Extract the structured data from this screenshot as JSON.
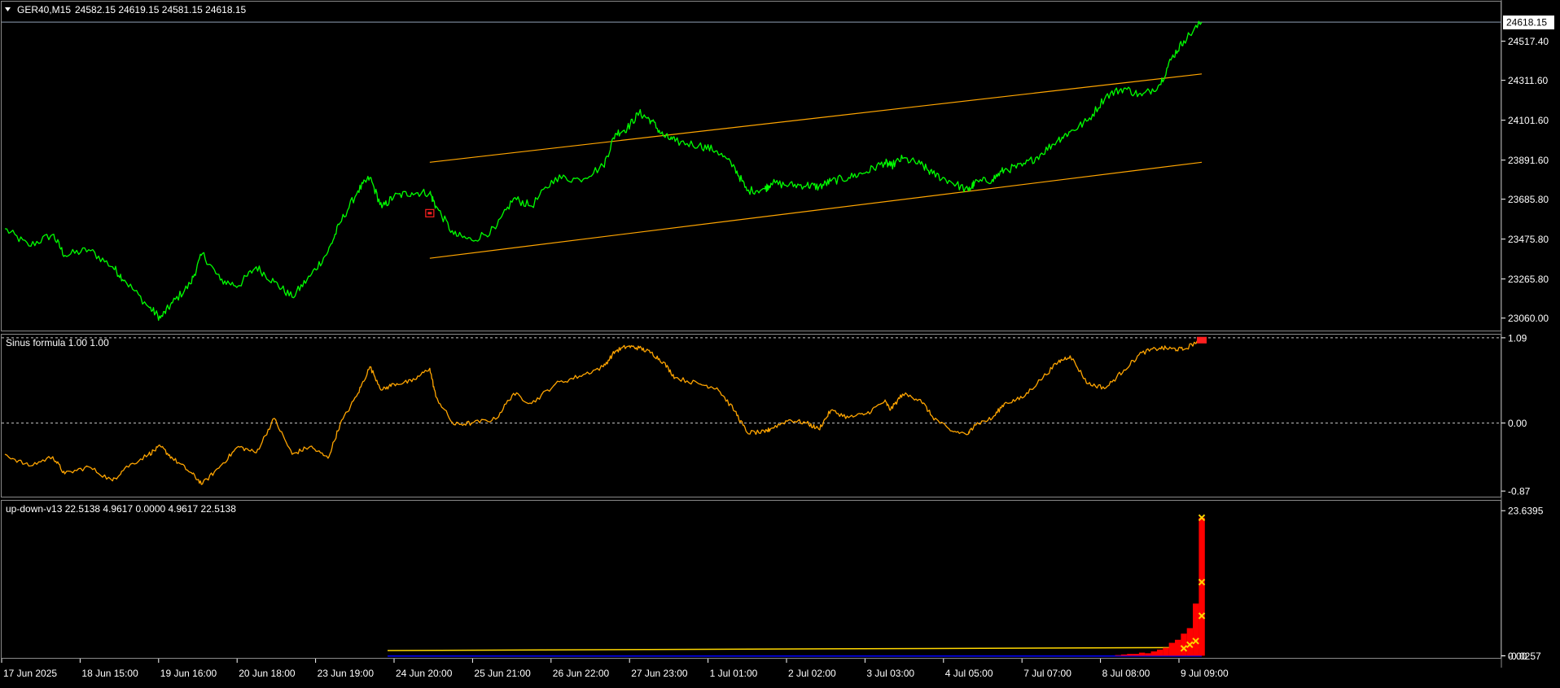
{
  "header": {
    "symbol_label": "GER40,M15",
    "ohlc": "24582.15 24619.15 24581.15 24618.15",
    "current_price": "24618.15"
  },
  "colors": {
    "background": "#000000",
    "price_line": "#00ff00",
    "channel": "#ffa500",
    "osc_line": "#ffa500",
    "up_down_bars": "#ff0000",
    "up_down_marker": "#ffd700",
    "up_down_line": "#ffd700",
    "baseline": "#0000ff",
    "axis_text": "#ffffff",
    "separator": "#808080",
    "price_marker_bg": "#ffffff"
  },
  "x_axis": {
    "labels": [
      "17 Jun 2025",
      "18 Jun 15:00",
      "19 Jun 16:00",
      "20 Jun 18:00",
      "23 Jun 19:00",
      "24 Jun 20:00",
      "25 Jun 21:00",
      "26 Jun 22:00",
      "27 Jun 23:00",
      "1 Jul 01:00",
      "2 Jul 02:00",
      "3 Jul 03:00",
      "4 Jul 05:00",
      "7 Jul 07:00",
      "8 Jul 08:00",
      "9 Jul 09:00"
    ]
  },
  "chart_data": [
    {
      "type": "line",
      "name": "main",
      "y_ticks": [
        "24517.40",
        "24311.60",
        "24101.60",
        "23891.60",
        "23685.80",
        "23475.80",
        "23265.80",
        "23060.00"
      ],
      "ylim": [
        23020,
        24640
      ],
      "x_index_range": [
        0,
        100
      ],
      "series": [
        {
          "name": "GER40,M15",
          "x": [
            0,
            2,
            4,
            5,
            7,
            9,
            10,
            12,
            13,
            14,
            15.5,
            16.5,
            18,
            19.5,
            21,
            22.5,
            24,
            25.5,
            27,
            28,
            29.5,
            30.5,
            31.5,
            32.5,
            34,
            35.5,
            36,
            37.5,
            39,
            41,
            42.5,
            44,
            46,
            48,
            50,
            51,
            52,
            53,
            54,
            55,
            56,
            58,
            59.5,
            61,
            62,
            63.5,
            64,
            65.5,
            67,
            68,
            69,
            70.5,
            72,
            73.5,
            74,
            75,
            76.5,
            77.5,
            79,
            80.5,
            81,
            82.5,
            83.5,
            85,
            86.5,
            88,
            89,
            90.5,
            92,
            93.5,
            95,
            96.5,
            97.5,
            98.5,
            100
          ],
          "values": [
            23530,
            23440,
            23500,
            23390,
            23420,
            23330,
            23260,
            23120,
            23060,
            23140,
            23240,
            23400,
            23260,
            23230,
            23330,
            23250,
            23170,
            23280,
            23410,
            23560,
            23730,
            23800,
            23640,
            23700,
            23720,
            23720,
            23650,
            23500,
            23470,
            23530,
            23690,
            23650,
            23800,
            23790,
            23860,
            24030,
            24060,
            24140,
            24100,
            24020,
            23990,
            23970,
            23940,
            23850,
            23730,
            23740,
            23770,
            23760,
            23760,
            23750,
            23780,
            23800,
            23830,
            23880,
            23860,
            23900,
            23870,
            23820,
            23780,
            23730,
            23770,
            23790,
            23840,
            23860,
            23920,
            24000,
            24040,
            24100,
            24230,
            24270,
            24230,
            24290,
            24430,
            24520,
            24618
          ]
        }
      ],
      "channel": {
        "upper": {
          "x": [
            35.5,
            100
          ],
          "values": [
            23880,
            24345
          ]
        },
        "lower": {
          "x": [
            35.5,
            100
          ],
          "values": [
            23375,
            23880
          ]
        }
      },
      "annotation": {
        "type": "red-square",
        "x": 35.5,
        "value": 23610
      }
    },
    {
      "type": "line",
      "name": "oscillator",
      "title": "Sinus formula 1.00 1.00",
      "y_ticks": [
        "1.09",
        "0.00",
        "-0.87"
      ],
      "level_lines": [
        1.09,
        0.0
      ],
      "ylim": [
        -0.9,
        1.12
      ],
      "x_index_range": [
        0,
        100
      ],
      "series": [
        {
          "name": "Sinus formula",
          "x": [
            0,
            2,
            4,
            5,
            7,
            9,
            10,
            12,
            13,
            14,
            15.5,
            16.5,
            18,
            19.5,
            21,
            22.5,
            24,
            25.5,
            27,
            28,
            29.5,
            30.5,
            31.5,
            32.5,
            34,
            35.5,
            36,
            37.5,
            39,
            41,
            42.5,
            44,
            46,
            48,
            50,
            51,
            52,
            53,
            54,
            55,
            56,
            58,
            59.5,
            61,
            62,
            63.5,
            64,
            65.5,
            67,
            68,
            69,
            70.5,
            72,
            73.5,
            74,
            75,
            76.5,
            77.5,
            79,
            80.5,
            81,
            82.5,
            83.5,
            85,
            86.5,
            88,
            89,
            90.5,
            92,
            93.5,
            95,
            96.5,
            97.5,
            98.5,
            100
          ],
          "values": [
            -0.4,
            -0.55,
            -0.43,
            -0.65,
            -0.56,
            -0.74,
            -0.58,
            -0.4,
            -0.3,
            -0.45,
            -0.63,
            -0.78,
            -0.55,
            -0.3,
            -0.38,
            0.06,
            -0.4,
            -0.3,
            -0.45,
            -0.02,
            0.38,
            0.72,
            0.42,
            0.5,
            0.53,
            0.7,
            0.34,
            -0.02,
            0.0,
            0.05,
            0.38,
            0.25,
            0.5,
            0.6,
            0.72,
            0.92,
            0.98,
            0.96,
            0.9,
            0.78,
            0.58,
            0.5,
            0.45,
            0.15,
            -0.12,
            -0.12,
            -0.07,
            0.04,
            0.0,
            -0.08,
            0.16,
            0.07,
            0.12,
            0.28,
            0.17,
            0.37,
            0.3,
            0.08,
            -0.1,
            -0.14,
            -0.02,
            0.06,
            0.25,
            0.32,
            0.55,
            0.78,
            0.86,
            0.5,
            0.45,
            0.68,
            0.9,
            0.96,
            0.95,
            0.94,
            1.08
          ]
        }
      ],
      "marker": {
        "type": "red-square",
        "x": 100,
        "value": 1.06
      }
    },
    {
      "type": "bar",
      "name": "up-down",
      "title": "up-down-v13 22.5138 4.9617 0.0000 4.9617 22.5138",
      "y_ticks": [
        "23.6395",
        "0.00",
        "-0.0257"
      ],
      "ylim": [
        -0.35,
        24.6
      ],
      "x_index_range": [
        0,
        100
      ],
      "bars": {
        "x": [
          93,
          93.5,
          94,
          94.5,
          95,
          95.5,
          96,
          96.5,
          97,
          97.5,
          98,
          98.5,
          99,
          99.5,
          100
        ],
        "values": [
          0.1,
          0.2,
          0.3,
          0.3,
          0.5,
          0.4,
          0.7,
          1.0,
          1.3,
          2.1,
          2.6,
          3.6,
          4.5,
          8.5,
          22.5
        ]
      },
      "markers": {
        "x": [
          98.5,
          99,
          99.5,
          100,
          100,
          100
        ],
        "values": [
          1.2,
          1.8,
          2.4,
          6.5,
          12.0,
          22.5
        ]
      },
      "yellow_line": {
        "x": [
          0,
          100
        ],
        "values": [
          0.85,
          1.35
        ]
      },
      "blue_baseline": {
        "x": [
          0,
          100
        ],
        "values": [
          -0.05,
          -0.05
        ]
      }
    }
  ]
}
